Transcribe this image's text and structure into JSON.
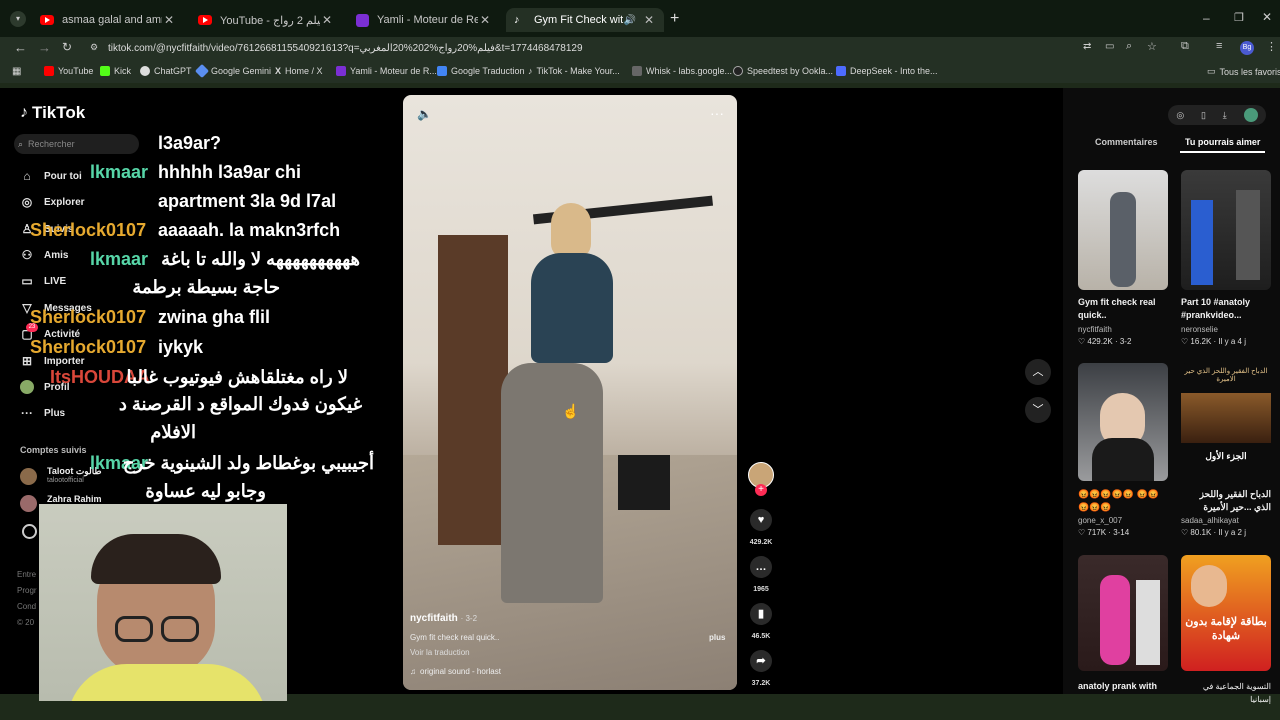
{
  "browser": {
    "tabs": [
      {
        "title": "asmaa galal and amr youssef -",
        "icon": "youtube-icon"
      },
      {
        "title": "",
        "icon": "youtube-icon"
      },
      {
        "title": "YouTube - فيلم 2 رواج",
        "icon": "youtube-icon"
      },
      {
        "title": "Yamli - Moteur de Recherche A",
        "icon": "yamli-icon"
      },
      {
        "title": "Gym Fit Check with NYC Fit",
        "icon": "tiktok-icon"
      }
    ],
    "url": "tiktok.com/@nycfitfaith/video/7612668115540921613?q=فيلم%20رواج%202%20المغربي&t=1774468478129",
    "bookmarks": [
      "YouTube",
      "Kick",
      "ChatGPT",
      "Google Gemini",
      "Home / X",
      "Yamli - Moteur de R...",
      "Google Traduction",
      "TikTok - Make Your...",
      "Whisk - labs.google...",
      "Speedtest by Ookla...",
      "DeepSeek - Into the..."
    ],
    "bookmarks_all": "Tous les favoris"
  },
  "tiktok": {
    "logo": "TikTok",
    "search_placeholder": "Rechercher",
    "nav": [
      "Pour toi",
      "Explorer",
      "Suivis",
      "Amis",
      "LIVE",
      "Messages",
      "Activité",
      "Importer",
      "Profil",
      "Plus"
    ],
    "activity_badge": "23",
    "following_header": "Comptes suivis",
    "following": [
      {
        "name": "Taloot طالوت",
        "handle": "talootofficial"
      },
      {
        "name": "Zahra Rahim",
        "handle": ""
      }
    ],
    "footer": [
      "Entre",
      "Progr",
      "Cond",
      "© 20"
    ]
  },
  "chat": [
    {
      "user": "",
      "msg": "l3a9ar?",
      "color": "#ffffff"
    },
    {
      "user": "lkmaar",
      "msg": "hhhhh l3a9ar chi",
      "color": "#57d6a8"
    },
    {
      "user": "",
      "msg": "apartment 3la 9d l7al",
      "color": "#ffffff"
    },
    {
      "user": "Sherlock0107",
      "msg": "aaaaah. la makn3rfch",
      "color": "#e6a92f"
    },
    {
      "user": "lkmaar",
      "msg": "ههههههههههه لا والله تا باغة",
      "color": "#57d6a8"
    },
    {
      "user": "",
      "msg": "حاجة بسيطة برطمة",
      "color": "#ffffff"
    },
    {
      "user": "Sherlock0107",
      "msg": "zwina gha flil",
      "color": "#e6a92f"
    },
    {
      "user": "Sherlock0107",
      "msg": "iykyk",
      "color": "#e6a92f"
    },
    {
      "user": "ItsHOUDAA",
      "msg": "لا راه مغتلقاهش فيوتيوب غالبا",
      "color": "#d9473a"
    },
    {
      "user": "",
      "msg": "غيكون فدوك المواقع د القرصنة د",
      "color": "#ffffff"
    },
    {
      "user": "",
      "msg": "الافلام",
      "color": "#ffffff"
    },
    {
      "user": "lkmaar",
      "msg": "أجيبيبي بوغطاط ولد الشينوية خرج",
      "color": "#57d6a8"
    },
    {
      "user": "",
      "msg": "وجابو ليه عساوة",
      "color": "#ffffff"
    }
  ],
  "video": {
    "author": "nycfitfaith",
    "date": "· 3-2",
    "caption": "Gym fit check real quick..",
    "more": "plus",
    "translate": "Voir la traduction",
    "sound": "original sound - horlast",
    "likes": "429.2K",
    "comments": "1965",
    "saves": "46.5K",
    "shares": "37.2K"
  },
  "right_panel": {
    "tabs": [
      "Commentaires",
      "Tu pourrais aimer"
    ],
    "recommendations": [
      {
        "title": "Gym fit check real quick..",
        "author": "nycfitfaith",
        "stats": "♡ 429.2K · 3-2"
      },
      {
        "title": "Part 10 #anatoly #prankvideo...",
        "author": "neronselie",
        "stats": "♡ 16.2K · Il y a 4 j"
      },
      {
        "title": "😡😡😡😡😡 😡😡😡😡😡",
        "author": "gone_x_007",
        "stats": "♡ 717K · 3-14"
      },
      {
        "title": "الدباح الفقير واللحز الذي ...حير الأميرة",
        "author": "sadaa_alhikayat",
        "stats": "♡ 80.1K · Il y a 2 j"
      },
      {
        "title": "anatoly prank with",
        "author": "",
        "stats": ""
      },
      {
        "title": "التسوية الجماعية في إسبانيا",
        "author": "",
        "stats": ""
      }
    ],
    "thumb_text_4": "الدباح الفقير واللحز الذي حير الاميرة",
    "thumb_text_4b": "الجزء الأول",
    "thumb_text_6": "بطاقة لإقامة بدون شهادة"
  },
  "colors": {
    "accent_pink": "#fe2c55",
    "chat_green": "#57d6a8",
    "chat_orange": "#e6a92f",
    "chat_red": "#d9473a"
  }
}
